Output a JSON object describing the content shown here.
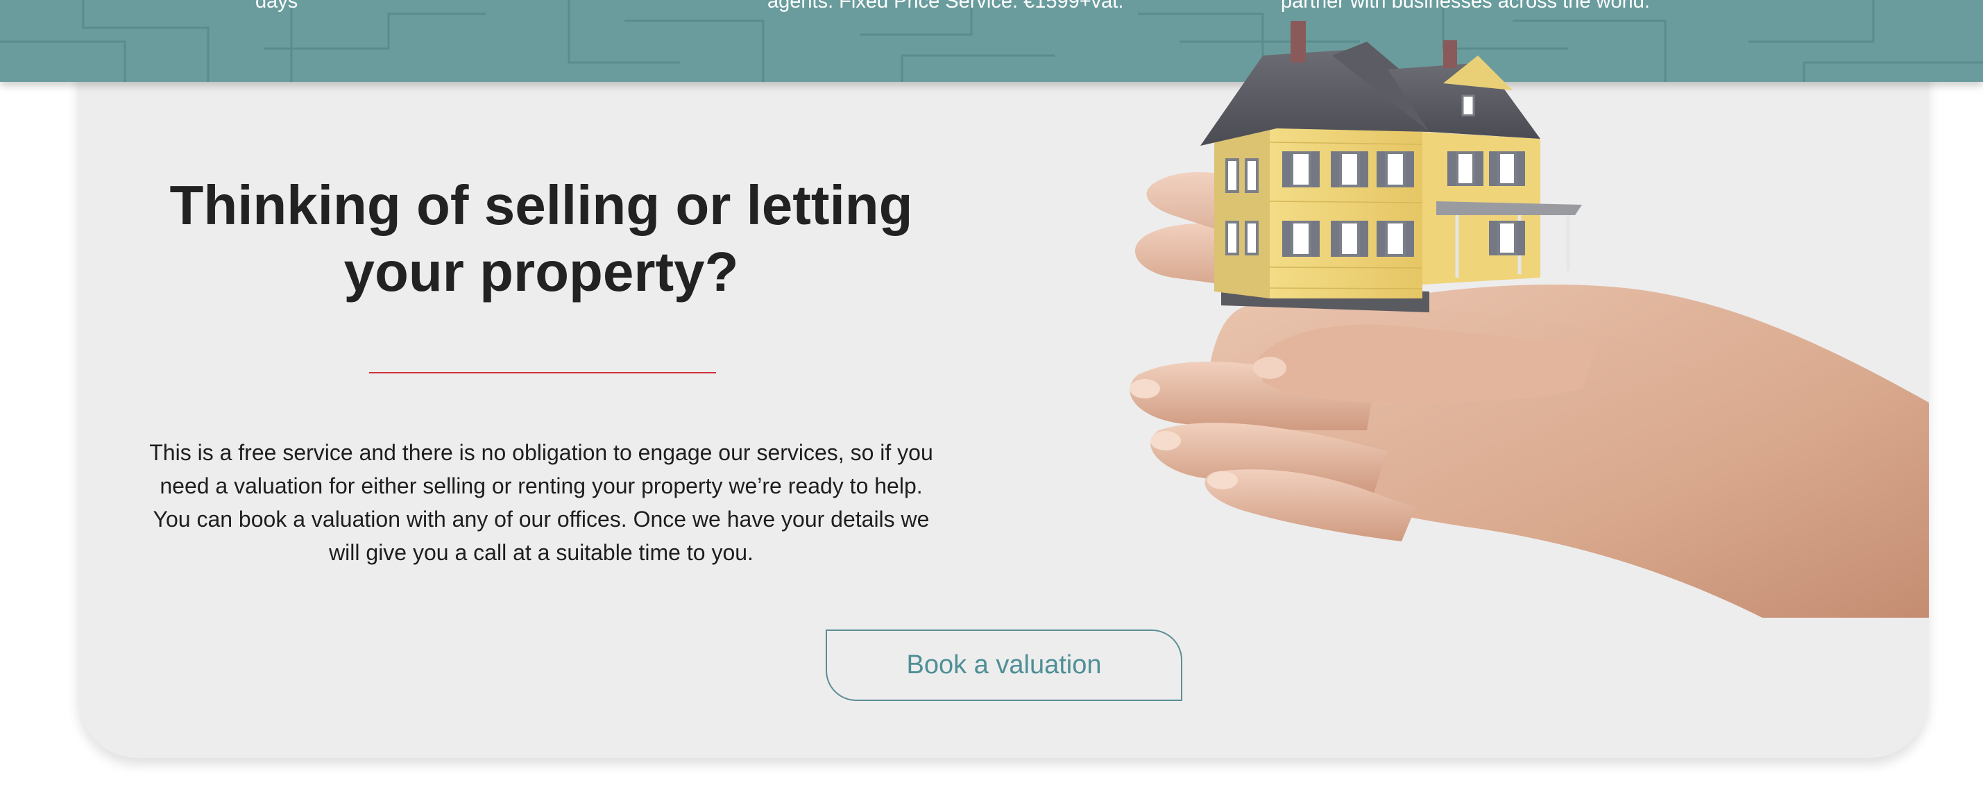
{
  "banner": {
    "texts": [
      "days",
      "agents. Fixed Price Service. €1599+vat.",
      "partner with businesses across the world."
    ],
    "background_color": "#6a9c9d"
  },
  "section": {
    "headline": "Thinking of selling or letting your property?",
    "body": "This is a free service and there is no obligation to engage our services, so if you need a valuation for either selling or renting your property we’re ready to help. You can book a valuation with any of our offices. Once we have your details we will give you a call at a suitable time to you.",
    "cta_label": "Book a valuation",
    "accent_color": "#cf2f3b",
    "card_color": "#ededed",
    "cta_color": "#4f8f96"
  },
  "images": {
    "hero": "hands-holding-model-house"
  }
}
